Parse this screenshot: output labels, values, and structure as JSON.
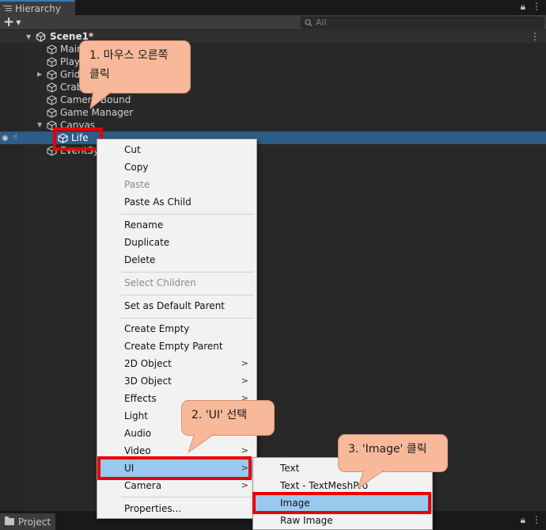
{
  "hierarchy": {
    "tab_label": "Hierarchy",
    "search_placeholder": "All",
    "scene_name": "Scene1*",
    "items": [
      {
        "name": "Main Camera"
      },
      {
        "name": "Player"
      },
      {
        "name": "Grid"
      },
      {
        "name": "Crab"
      },
      {
        "name": "Camera Bound"
      },
      {
        "name": "Game Manager"
      },
      {
        "name": "Canvas"
      },
      {
        "name": "Life"
      },
      {
        "name": "EventSystem"
      }
    ]
  },
  "context_menu": {
    "items": [
      {
        "label": "Cut",
        "enabled": true
      },
      {
        "label": "Copy",
        "enabled": true
      },
      {
        "label": "Paste",
        "enabled": false
      },
      {
        "label": "Paste As Child",
        "enabled": true
      },
      {
        "label": "Rename",
        "enabled": true
      },
      {
        "label": "Duplicate",
        "enabled": true
      },
      {
        "label": "Delete",
        "enabled": true
      },
      {
        "label": "Select Children",
        "enabled": false
      },
      {
        "label": "Set as Default Parent",
        "enabled": true
      },
      {
        "label": "Create Empty",
        "enabled": true
      },
      {
        "label": "Create Empty Parent",
        "enabled": true
      },
      {
        "label": "2D Object",
        "enabled": true,
        "submenu": true
      },
      {
        "label": "3D Object",
        "enabled": true,
        "submenu": true
      },
      {
        "label": "Effects",
        "enabled": true,
        "submenu": true
      },
      {
        "label": "Light",
        "enabled": true,
        "submenu": true
      },
      {
        "label": "Audio",
        "enabled": true,
        "submenu": true
      },
      {
        "label": "Video",
        "enabled": true,
        "submenu": true
      },
      {
        "label": "UI",
        "enabled": true,
        "submenu": true,
        "highlighted": true
      },
      {
        "label": "Camera",
        "enabled": true,
        "submenu": true
      },
      {
        "label": "Properties...",
        "enabled": true
      }
    ],
    "submenu_arrow": ">"
  },
  "ui_submenu": {
    "items": [
      {
        "label": "Text"
      },
      {
        "label": "Text - TextMeshPro"
      },
      {
        "label": "Image",
        "highlighted": true
      },
      {
        "label": "Raw Image"
      }
    ]
  },
  "callouts": {
    "step1_line1": "1. 마우스 오른쪽",
    "step1_line2": "클릭",
    "step2": "2. 'UI' 선택",
    "step3": "3. 'Image' 클릭"
  },
  "project_tab": {
    "label": "Project"
  },
  "colors": {
    "selection": "#2c5d87",
    "menu_highlight": "#99c9ef",
    "annotation_red": "#e90000",
    "callout_fill": "#f8b99a"
  }
}
